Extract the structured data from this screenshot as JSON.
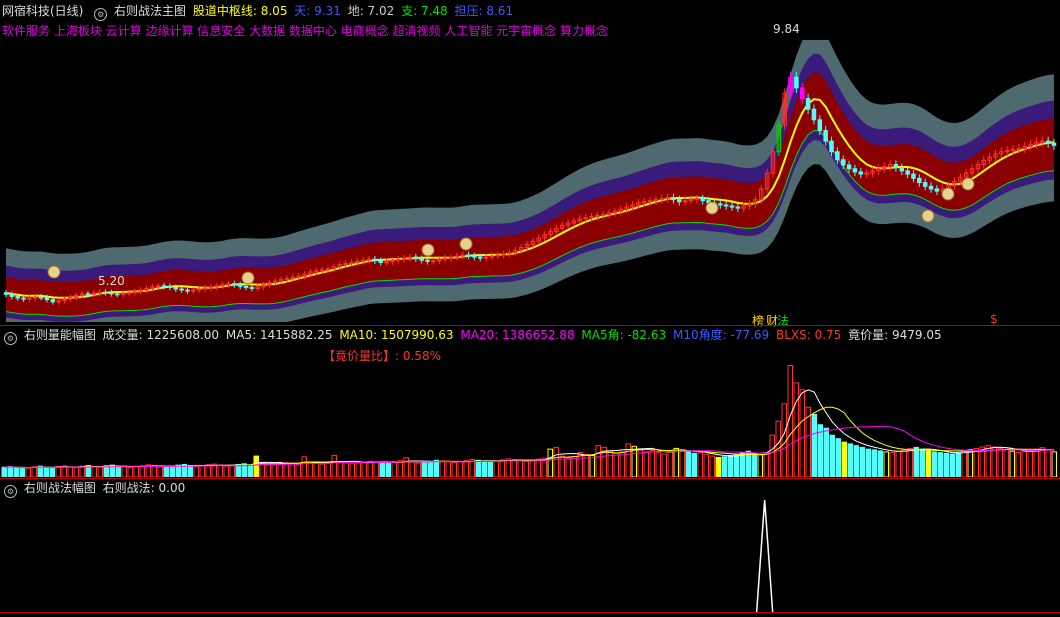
{
  "main_header": {
    "stock": "网宿科技(日线)",
    "indicator": "右则战法主图",
    "central_label": "股道中枢线: 8.05",
    "sky_label": "天: 9.31",
    "earth_label": "地: 7.02",
    "support_label": "支: 7.48",
    "pressure_label": "担压: 8.61"
  },
  "concepts": "软件服务 上海板块 云计算 边缘计算 信息安全 大数据 数据中心 电商概念 超清视频 人工智能 元宇宙概念 算力概念",
  "price_high_label": "9.84",
  "price_low_label": "5.20",
  "markers": {
    "m1": "榜",
    "m2": "财",
    "m3": "法",
    "m4": "$"
  },
  "volume_header": {
    "title": "右则量能幅图",
    "vol_label": "成交量: 1225608.00",
    "ma5_label": "MA5: 1415882.25",
    "ma10_label": "MA10: 1507990.63",
    "ma20_label": "MA20: 1386652.88",
    "ma5_angle_label": "MA5角: -82.63",
    "m10_angle_label": "M10角度: -77.69",
    "blxs_label": "BLXS: 0.75",
    "auction_price_label": "竟价量: 9479.05",
    "auction_ratio_label": "【竟价量比】: 0.58%"
  },
  "bottom_header": {
    "title": "右则战法幅图",
    "value_label": "右则战法: 0.00"
  },
  "colors": {
    "up": "#ff3232",
    "down": "#54fcfc",
    "magenta": "#ff00ff",
    "green": "#00e000",
    "yellow": "#ffff00",
    "band_outer": "#4e6a70",
    "band_mid": "#3a1a7a",
    "band_inner": "#8a0000",
    "ma10": "#ff00ff",
    "ma20": "#ff00ff",
    "ma5": "#ffffff",
    "maY": "#ffff00"
  },
  "chart_data": [
    {
      "type": "candlestick",
      "title": "右则战法主图",
      "ylim": [
        4.9,
        10.2
      ],
      "x": [
        0,
        1,
        2,
        3,
        4,
        5,
        6,
        7,
        8,
        9,
        10,
        11,
        12,
        13,
        14,
        15,
        16,
        17,
        18,
        19,
        20,
        21,
        22,
        23,
        24,
        25,
        26,
        27,
        28,
        29,
        30,
        31,
        32,
        33,
        34,
        35,
        36,
        37,
        38,
        39,
        40,
        41,
        42,
        43,
        44,
        45,
        46,
        47,
        48,
        49,
        50,
        51,
        52,
        53,
        54,
        55,
        56,
        57,
        58,
        59,
        60,
        61,
        62,
        63,
        64,
        65,
        66,
        67,
        68,
        69,
        70,
        71,
        72,
        73,
        74,
        75,
        76,
        77,
        78,
        79,
        80,
        81,
        82,
        83,
        84,
        85,
        86,
        87,
        88,
        89,
        90,
        91,
        92,
        93,
        94,
        95,
        96,
        97,
        98,
        99,
        100,
        101,
        102,
        103,
        104,
        105,
        106,
        107,
        108,
        109,
        110,
        111,
        112,
        113,
        114,
        115,
        116,
        117,
        118,
        119,
        120,
        121,
        122,
        123,
        124,
        125,
        126,
        127,
        128,
        129,
        130,
        131,
        132,
        133,
        134,
        135,
        136,
        137,
        138,
        139,
        140,
        141,
        142,
        143,
        144,
        145,
        146,
        147,
        148,
        149,
        150,
        151,
        152,
        153,
        154,
        155,
        156,
        157,
        158,
        159,
        160,
        161,
        162,
        163,
        164,
        165,
        166,
        167,
        168,
        169,
        170,
        171,
        172,
        173,
        174,
        175
      ],
      "open": [
        5.45,
        5.42,
        5.38,
        5.35,
        5.33,
        5.35,
        5.37,
        5.36,
        5.32,
        5.28,
        5.3,
        5.33,
        5.36,
        5.4,
        5.43,
        5.42,
        5.44,
        5.46,
        5.45,
        5.43,
        5.42,
        5.44,
        5.45,
        5.47,
        5.5,
        5.53,
        5.56,
        5.58,
        5.57,
        5.55,
        5.52,
        5.5,
        5.48,
        5.5,
        5.52,
        5.54,
        5.56,
        5.58,
        5.6,
        5.62,
        5.6,
        5.57,
        5.55,
        5.53,
        5.56,
        5.6,
        5.64,
        5.67,
        5.7,
        5.72,
        5.74,
        5.76,
        5.8,
        5.84,
        5.86,
        5.88,
        5.9,
        5.94,
        5.98,
        6.0,
        6.02,
        6.04,
        6.06,
        6.08,
        6.05,
        6.02,
        6.03,
        6.06,
        6.08,
        6.1,
        6.12,
        6.09,
        6.06,
        6.04,
        6.05,
        6.08,
        6.1,
        6.12,
        6.14,
        6.16,
        6.14,
        6.12,
        6.1,
        6.12,
        6.14,
        6.16,
        6.18,
        6.2,
        6.25,
        6.3,
        6.36,
        6.42,
        6.48,
        6.54,
        6.6,
        6.66,
        6.72,
        6.76,
        6.8,
        6.84,
        6.86,
        6.88,
        6.9,
        6.92,
        6.95,
        6.98,
        7.02,
        7.06,
        7.1,
        7.14,
        7.16,
        7.18,
        7.2,
        7.22,
        7.24,
        7.2,
        7.16,
        7.18,
        7.2,
        7.22,
        7.18,
        7.14,
        7.12,
        7.1,
        7.08,
        7.06,
        7.04,
        7.08,
        7.12,
        7.2,
        7.4,
        7.7,
        8.1,
        8.6,
        9.2,
        9.5,
        9.3,
        9.1,
        8.9,
        8.7,
        8.5,
        8.3,
        8.1,
        7.95,
        7.85,
        7.78,
        7.72,
        7.68,
        7.7,
        7.74,
        7.78,
        7.82,
        7.86,
        7.8,
        7.74,
        7.68,
        7.6,
        7.52,
        7.45,
        7.4,
        7.36,
        7.4,
        7.46,
        7.54,
        7.62,
        7.7,
        7.78,
        7.86,
        7.94,
        8.0,
        8.06,
        8.1,
        8.12,
        8.14,
        8.16,
        8.2,
        8.24,
        8.28,
        8.3,
        8.26
      ],
      "close": [
        5.42,
        5.38,
        5.35,
        5.33,
        5.35,
        5.37,
        5.36,
        5.32,
        5.28,
        5.3,
        5.33,
        5.36,
        5.4,
        5.43,
        5.42,
        5.44,
        5.46,
        5.45,
        5.43,
        5.42,
        5.44,
        5.45,
        5.47,
        5.5,
        5.53,
        5.56,
        5.58,
        5.57,
        5.55,
        5.52,
        5.5,
        5.48,
        5.5,
        5.52,
        5.54,
        5.56,
        5.58,
        5.6,
        5.62,
        5.6,
        5.57,
        5.55,
        5.53,
        5.56,
        5.6,
        5.64,
        5.67,
        5.7,
        5.72,
        5.74,
        5.76,
        5.8,
        5.84,
        5.86,
        5.88,
        5.9,
        5.94,
        5.98,
        6.0,
        6.02,
        6.04,
        6.06,
        6.08,
        6.05,
        6.02,
        6.03,
        6.06,
        6.08,
        6.1,
        6.12,
        6.09,
        6.06,
        6.04,
        6.05,
        6.08,
        6.1,
        6.12,
        6.14,
        6.16,
        6.14,
        6.12,
        6.1,
        6.12,
        6.14,
        6.16,
        6.18,
        6.2,
        6.25,
        6.3,
        6.36,
        6.42,
        6.48,
        6.54,
        6.6,
        6.66,
        6.72,
        6.76,
        6.8,
        6.84,
        6.86,
        6.88,
        6.9,
        6.92,
        6.95,
        6.98,
        7.02,
        7.06,
        7.1,
        7.14,
        7.16,
        7.18,
        7.2,
        7.22,
        7.24,
        7.2,
        7.16,
        7.18,
        7.2,
        7.22,
        7.18,
        7.14,
        7.12,
        7.1,
        7.08,
        7.06,
        7.04,
        7.08,
        7.12,
        7.2,
        7.4,
        7.7,
        8.1,
        8.6,
        9.2,
        9.5,
        9.3,
        9.1,
        8.9,
        8.7,
        8.5,
        8.3,
        8.1,
        7.95,
        7.85,
        7.78,
        7.72,
        7.68,
        7.7,
        7.74,
        7.78,
        7.82,
        7.86,
        7.8,
        7.74,
        7.68,
        7.6,
        7.52,
        7.45,
        7.4,
        7.36,
        7.4,
        7.46,
        7.54,
        7.62,
        7.7,
        7.78,
        7.86,
        7.94,
        8.0,
        8.06,
        8.1,
        8.12,
        8.14,
        8.16,
        8.2,
        8.24,
        8.28,
        8.3,
        8.26,
        8.22
      ],
      "high_label_value": 9.84,
      "low_label_value": 5.2
    },
    {
      "type": "bar",
      "title": "右则量能幅图",
      "series": [
        {
          "name": "成交量",
          "values": [
            0.28,
            0.3,
            0.26,
            0.27,
            0.25,
            0.29,
            0.31,
            0.28,
            0.26,
            0.3,
            0.32,
            0.29,
            0.27,
            0.31,
            0.33,
            0.3,
            0.28,
            0.32,
            0.34,
            0.31,
            0.29,
            0.27,
            0.3,
            0.32,
            0.35,
            0.33,
            0.3,
            0.28,
            0.31,
            0.34,
            0.36,
            0.33,
            0.3,
            0.32,
            0.35,
            0.37,
            0.34,
            0.31,
            0.33,
            0.36,
            0.38,
            0.35,
            0.6,
            0.4,
            0.37,
            0.35,
            0.38,
            0.41,
            0.39,
            0.36,
            0.58,
            0.42,
            0.4,
            0.37,
            0.39,
            0.62,
            0.44,
            0.41,
            0.38,
            0.4,
            0.43,
            0.45,
            0.42,
            0.39,
            0.41,
            0.44,
            0.47,
            0.55,
            0.43,
            0.4,
            0.42,
            0.45,
            0.48,
            0.46,
            0.43,
            0.41,
            0.44,
            0.47,
            0.5,
            0.48,
            0.45,
            0.43,
            0.46,
            0.49,
            0.52,
            0.5,
            0.47,
            0.45,
            0.48,
            0.51,
            0.54,
            0.8,
            0.85,
            0.6,
            0.55,
            0.58,
            0.7,
            0.65,
            0.62,
            0.9,
            0.85,
            0.75,
            0.68,
            0.72,
            0.95,
            0.88,
            0.8,
            0.72,
            0.76,
            0.7,
            0.66,
            0.74,
            0.82,
            0.78,
            0.72,
            0.68,
            0.7,
            0.65,
            0.6,
            0.56,
            0.58,
            0.62,
            0.66,
            0.7,
            0.74,
            0.68,
            0.64,
            0.7,
            1.2,
            1.6,
            2.1,
            3.2,
            2.7,
            2.5,
            2.0,
            1.8,
            1.5,
            1.4,
            1.2,
            1.1,
            1.0,
            0.95,
            0.9,
            0.85,
            0.8,
            0.78,
            0.75,
            0.72,
            0.7,
            0.74,
            0.78,
            0.82,
            0.85,
            0.8,
            0.76,
            0.72,
            0.7,
            0.68,
            0.66,
            0.7,
            0.74,
            0.78,
            0.82,
            0.86,
            0.9,
            0.86,
            0.82,
            0.78,
            0.74,
            0.7,
            0.72,
            0.76,
            0.8,
            0.84,
            0.78,
            0.72
          ]
        }
      ]
    },
    {
      "type": "line",
      "title": "右则战法幅图",
      "series": [
        {
          "name": "右则战法",
          "spike_index": 130,
          "values": [
            0
          ]
        }
      ]
    }
  ]
}
